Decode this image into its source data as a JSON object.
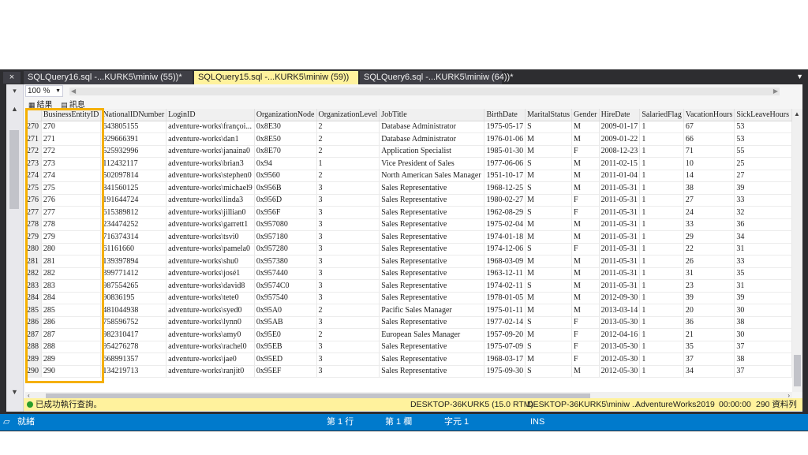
{
  "tabs": [
    {
      "label": "SQLQuery16.sql -...KURK5\\miniw (55))*",
      "active": false
    },
    {
      "label": "SQLQuery15.sql -...KURK5\\miniw (59))",
      "active": true
    },
    {
      "label": "SQLQuery6.sql -...KURK5\\miniw (64))*",
      "active": false
    }
  ],
  "tab_close_label": "×",
  "zoom": "100 %",
  "result_tabs": [
    {
      "label": "結果",
      "icon": "grid-icon"
    },
    {
      "label": "訊息",
      "icon": "message-icon"
    }
  ],
  "columns": [
    "BusinessEntityID",
    "NationalIDNumber",
    "LoginID",
    "OrganizationNode",
    "OrganizationLevel",
    "JobTitle",
    "BirthDate",
    "MaritalStatus",
    "Gender",
    "HireDate",
    "SalariedFlag",
    "VacationHours",
    "SickLeaveHours"
  ],
  "rows": [
    [
      "270",
      "270",
      "643805155",
      "adventure-works\\françoi...",
      "0x8E30",
      "2",
      "Database Administrator",
      "1975-05-17",
      "S",
      "M",
      "2009-01-17",
      "1",
      "67",
      "53"
    ],
    [
      "271",
      "271",
      "929666391",
      "adventure-works\\dan1",
      "0x8E50",
      "2",
      "Database Administrator",
      "1976-01-06",
      "M",
      "M",
      "2009-01-22",
      "1",
      "66",
      "53"
    ],
    [
      "272",
      "272",
      "525932996",
      "adventure-works\\janaina0",
      "0x8E70",
      "2",
      "Application Specialist",
      "1985-01-30",
      "M",
      "F",
      "2008-12-23",
      "1",
      "71",
      "55"
    ],
    [
      "273",
      "273",
      "112432117",
      "adventure-works\\brian3",
      "0x94",
      "1",
      "Vice President of Sales",
      "1977-06-06",
      "S",
      "M",
      "2011-02-15",
      "1",
      "10",
      "25"
    ],
    [
      "274",
      "274",
      "502097814",
      "adventure-works\\stephen0",
      "0x9560",
      "2",
      "North American Sales Manager",
      "1951-10-17",
      "M",
      "M",
      "2011-01-04",
      "1",
      "14",
      "27"
    ],
    [
      "275",
      "275",
      "841560125",
      "adventure-works\\michael9",
      "0x956B",
      "3",
      "Sales Representative",
      "1968-12-25",
      "S",
      "M",
      "2011-05-31",
      "1",
      "38",
      "39"
    ],
    [
      "276",
      "276",
      "191644724",
      "adventure-works\\linda3",
      "0x956D",
      "3",
      "Sales Representative",
      "1980-02-27",
      "M",
      "F",
      "2011-05-31",
      "1",
      "27",
      "33"
    ],
    [
      "277",
      "277",
      "615389812",
      "adventure-works\\jillian0",
      "0x956F",
      "3",
      "Sales Representative",
      "1962-08-29",
      "S",
      "F",
      "2011-05-31",
      "1",
      "24",
      "32"
    ],
    [
      "278",
      "278",
      "234474252",
      "adventure-works\\garrett1",
      "0x957080",
      "3",
      "Sales Representative",
      "1975-02-04",
      "M",
      "M",
      "2011-05-31",
      "1",
      "33",
      "36"
    ],
    [
      "279",
      "279",
      "716374314",
      "adventure-works\\tsvi0",
      "0x957180",
      "3",
      "Sales Representative",
      "1974-01-18",
      "M",
      "M",
      "2011-05-31",
      "1",
      "29",
      "34"
    ],
    [
      "280",
      "280",
      "61161660",
      "adventure-works\\pamela0",
      "0x957280",
      "3",
      "Sales Representative",
      "1974-12-06",
      "S",
      "F",
      "2011-05-31",
      "1",
      "22",
      "31"
    ],
    [
      "281",
      "281",
      "139397894",
      "adventure-works\\shu0",
      "0x957380",
      "3",
      "Sales Representative",
      "1968-03-09",
      "M",
      "M",
      "2011-05-31",
      "1",
      "26",
      "33"
    ],
    [
      "282",
      "282",
      "399771412",
      "adventure-works\\josé1",
      "0x957440",
      "3",
      "Sales Representative",
      "1963-12-11",
      "M",
      "M",
      "2011-05-31",
      "1",
      "31",
      "35"
    ],
    [
      "283",
      "283",
      "987554265",
      "adventure-works\\david8",
      "0x9574C0",
      "3",
      "Sales Representative",
      "1974-02-11",
      "S",
      "M",
      "2011-05-31",
      "1",
      "23",
      "31"
    ],
    [
      "284",
      "284",
      "90836195",
      "adventure-works\\tete0",
      "0x957540",
      "3",
      "Sales Representative",
      "1978-01-05",
      "M",
      "M",
      "2012-09-30",
      "1",
      "39",
      "39"
    ],
    [
      "285",
      "285",
      "481044938",
      "adventure-works\\syed0",
      "0x95A0",
      "2",
      "Pacific Sales Manager",
      "1975-01-11",
      "M",
      "M",
      "2013-03-14",
      "1",
      "20",
      "30"
    ],
    [
      "286",
      "286",
      "758596752",
      "adventure-works\\lynn0",
      "0x95AB",
      "3",
      "Sales Representative",
      "1977-02-14",
      "S",
      "F",
      "2013-05-30",
      "1",
      "36",
      "38"
    ],
    [
      "287",
      "287",
      "982310417",
      "adventure-works\\amy0",
      "0x95E0",
      "2",
      "European Sales Manager",
      "1957-09-20",
      "M",
      "F",
      "2012-04-16",
      "1",
      "21",
      "30"
    ],
    [
      "288",
      "288",
      "954276278",
      "adventure-works\\rachel0",
      "0x95EB",
      "3",
      "Sales Representative",
      "1975-07-09",
      "S",
      "F",
      "2013-05-30",
      "1",
      "35",
      "37"
    ],
    [
      "289",
      "289",
      "668991357",
      "adventure-works\\jae0",
      "0x95ED",
      "3",
      "Sales Representative",
      "1968-03-17",
      "M",
      "F",
      "2012-05-30",
      "1",
      "37",
      "38"
    ],
    [
      "290",
      "290",
      "134219713",
      "adventure-works\\ranjit0",
      "0x95EF",
      "3",
      "Sales Representative",
      "1975-09-30",
      "S",
      "M",
      "2012-05-30",
      "1",
      "34",
      "37"
    ]
  ],
  "query_status": {
    "message": "已成功執行查詢。",
    "server": "DESKTOP-36KURK5 (15.0 RTM)",
    "login": "DESKTOP-36KURK5\\miniw ...",
    "database": "AdventureWorks2019",
    "elapsed": "00:00:00",
    "row_count": "290 資料列"
  },
  "app_status": {
    "ready": "就緒",
    "line": "第 1 行",
    "column": "第 1 欄",
    "char": "字元 1",
    "mode": "INS"
  },
  "colors": {
    "active_tab": "#fff29d",
    "status_bar": "#007acc",
    "highlight": "#f5b000",
    "success": "#2a9d2a"
  }
}
